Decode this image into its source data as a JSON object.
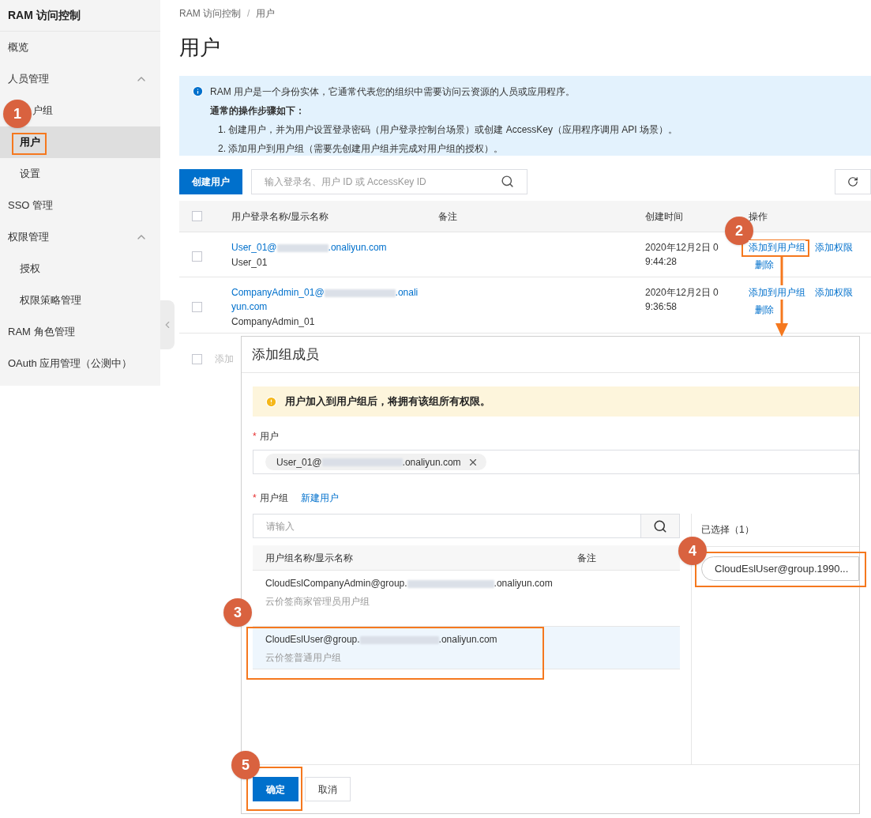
{
  "sidebar": {
    "title": "RAM 访问控制",
    "items": [
      {
        "label": "概览",
        "selected": false
      },
      {
        "label": "人员管理",
        "expanded": true,
        "children": [
          {
            "label": "户组",
            "selected": false
          },
          {
            "label": "用户",
            "selected": true
          },
          {
            "label": "设置",
            "selected": false
          }
        ]
      },
      {
        "label": "SSO 管理",
        "selected": false
      },
      {
        "label": "权限管理",
        "expanded": true,
        "children": [
          {
            "label": "授权",
            "selected": false
          },
          {
            "label": "权限策略管理",
            "selected": false
          }
        ]
      },
      {
        "label": "RAM 角色管理",
        "selected": false
      },
      {
        "label": "OAuth 应用管理（公测中）",
        "selected": false
      }
    ]
  },
  "breadcrumb": {
    "items": [
      "RAM 访问控制",
      "用户"
    ],
    "separator": "/"
  },
  "page_title": "用户",
  "notice": {
    "text": "RAM 用户是一个身份实体，它通常代表您的组织中需要访问云资源的人员或应用程序。",
    "heading": "通常的操作步骤如下：",
    "steps": [
      "1. 创建用户，并为用户设置登录密码（用户登录控制台场景）或创建 AccessKey（应用程序调用 API 场景）。",
      "2. 添加用户到用户组（需要先创建用户组并完成对用户组的授权）。"
    ]
  },
  "toolbar": {
    "create_button": "创建用户",
    "search_placeholder": "输入登录名、用户 ID 或 AccessKey ID"
  },
  "table": {
    "select_all_checked": false,
    "columns": [
      "用户登录名称/显示名称",
      "备注",
      "创建时间",
      "操作"
    ],
    "rows": [
      {
        "checked": false,
        "login_prefix": "User_01@",
        "login_suffix": ".onaliyun.com",
        "display_name": "User_01",
        "created": "2020年12月2日 09:44:28",
        "actions": [
          "添加到用户组",
          "添加权限",
          "删除"
        ]
      },
      {
        "checked": false,
        "login_prefix": "CompanyAdmin_01@",
        "login_suffix": ".onaliyun.com",
        "display_name": "CompanyAdmin_01",
        "created": "2020年12月2日 09:36:58",
        "actions": [
          "添加到用户组",
          "添加权限",
          "删除"
        ]
      }
    ],
    "batch_checked": false,
    "batch_action": "添加"
  },
  "dialog": {
    "title": "添加组成员",
    "warning": "用户加入到用户组后，将拥有该组所有权限。",
    "required_mark": "*",
    "user_label": "用户",
    "user_tags": [
      {
        "prefix": "User_01@",
        "suffix": ".onaliyun.com"
      }
    ],
    "group_label": "用户组",
    "new_link": "新建用户",
    "search_placeholder": "请输入",
    "columns": [
      "用户组名称/显示名称",
      "备注"
    ],
    "groups": [
      {
        "prefix": "CloudEslCompanyAdmin@group.",
        "suffix": ".onaliyun.com",
        "display_name": "云价签商家管理员用户组",
        "selected": false
      },
      {
        "prefix": "CloudEslUser@group.",
        "suffix": ".onaliyun.com",
        "display_name": "云价签普通用户组",
        "selected": true
      }
    ],
    "selected_label": "已选择（1）",
    "selected_tags": [
      "CloudEslUser@group.1990..."
    ],
    "confirm": "确定",
    "cancel": "取消"
  },
  "callouts": [
    "1",
    "2",
    "3",
    "4",
    "5"
  ]
}
